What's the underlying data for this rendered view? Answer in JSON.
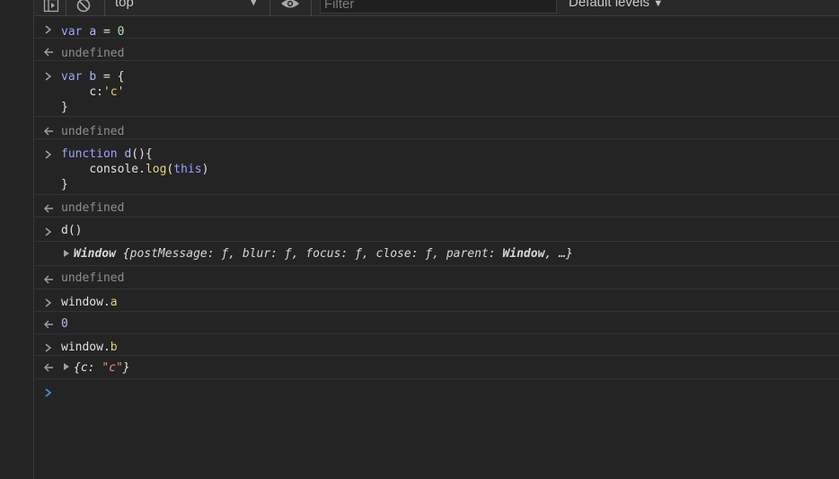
{
  "toolbar": {
    "context": "top",
    "filter_placeholder": "Filter",
    "levels": "Default levels"
  },
  "console": {
    "e1": {
      "kw": "var",
      "name": "a",
      "op": " = ",
      "val": "0"
    },
    "r1": "undefined",
    "e2": {
      "kw": "var",
      "name": "b",
      "op": " = {",
      "key": "c:",
      "val": "'c'",
      "close": "}"
    },
    "r2": "undefined",
    "e3": {
      "kw": "function",
      "name": "d",
      "sig": "(){",
      "obj": "console.",
      "method": "log",
      "args_open": "(",
      "this": "this",
      "args_close": ")",
      "close": "}"
    },
    "r3": "undefined",
    "e4": {
      "call": "d()"
    },
    "log4": {
      "cls": "Window",
      "open": " {",
      "body": "postMessage: ƒ, blur: ƒ, focus: ƒ, close: ƒ, parent: ",
      "win": "Window",
      "tail": ", …}"
    },
    "r4": "undefined",
    "e5": {
      "obj": "window.",
      "prop": "a"
    },
    "r5": "0",
    "e6": {
      "obj": "window.",
      "prop": "b"
    },
    "r6": {
      "open": "{c: ",
      "val": "\"c\"",
      "close": "}"
    }
  },
  "colors": {
    "background": "#242424",
    "prompt_active": "#4a90e2"
  }
}
